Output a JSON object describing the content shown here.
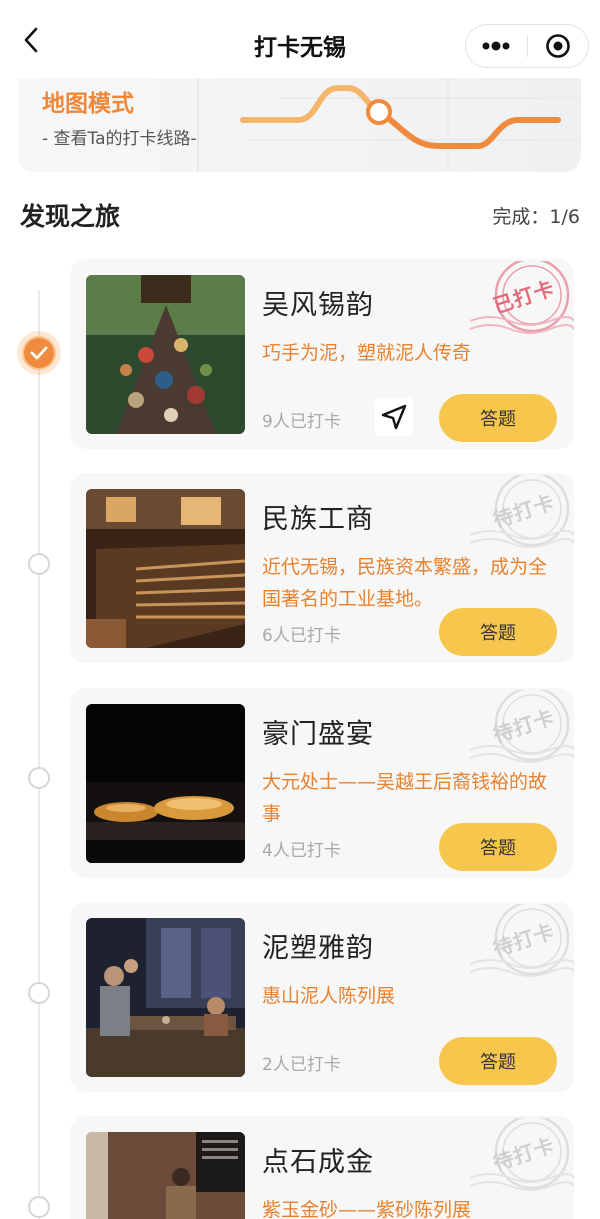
{
  "nav": {
    "title": "打卡无锡"
  },
  "banner": {
    "title": "地图模式",
    "subtitle": "- 查看Ta的打卡线路-"
  },
  "section": {
    "title": "发现之旅",
    "progress": "完成：1/6"
  },
  "answer_label": "答题",
  "cards": [
    {
      "title": "吴风锡韵",
      "desc": "巧手为泥，塑就泥人传奇",
      "count": "9人已打卡",
      "stamp": "已打卡",
      "status": "done"
    },
    {
      "title": "民族工商",
      "desc": "近代无锡，民族资本繁盛，成为全国著名的工业基地。",
      "count": "6人已打卡",
      "stamp": "待打卡",
      "status": "pending"
    },
    {
      "title": "豪门盛宴",
      "desc": "大元处士——吴越王后裔钱裕的故事",
      "count": "4人已打卡",
      "stamp": "待打卡",
      "status": "pending"
    },
    {
      "title": "泥塑雅韵",
      "desc": "惠山泥人陈列展",
      "count": "2人已打卡",
      "stamp": "待打卡",
      "status": "pending"
    },
    {
      "title": "点石成金",
      "desc": "紫玉金砂——紫砂陈列展",
      "count": "",
      "stamp": "待打卡",
      "status": "pending"
    }
  ],
  "colors": {
    "accent_orange": "#f08a3c",
    "button_yellow": "#f7c64d",
    "desc_orange": "#e8822e",
    "stamp_done": "#e46a7a",
    "stamp_pending": "#cfcfcf"
  },
  "icons": {
    "back": "chevron-left-icon",
    "more": "more-dots-icon",
    "close": "target-close-icon",
    "navigate": "navigate-arrow-icon",
    "check": "check-icon"
  }
}
